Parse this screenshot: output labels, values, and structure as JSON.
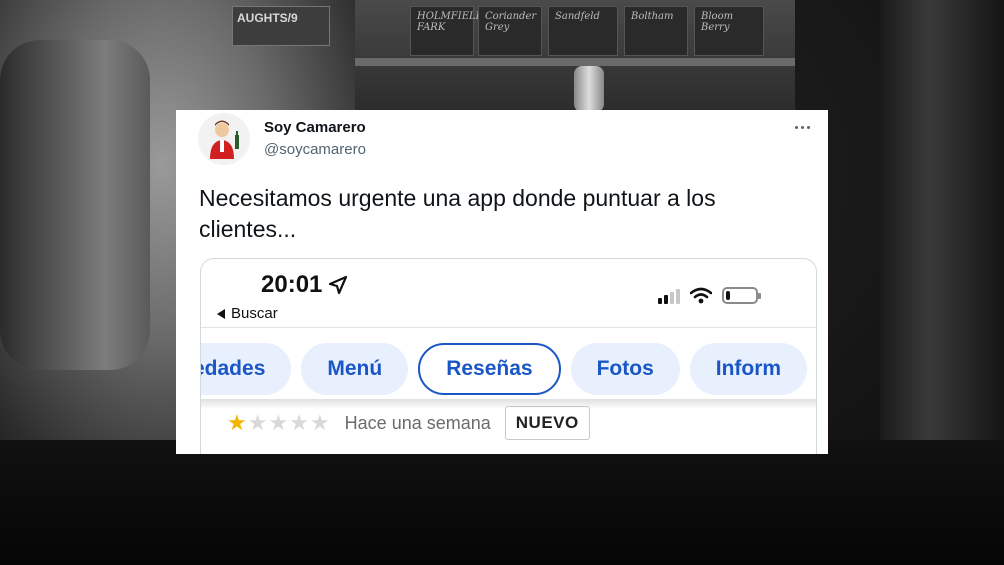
{
  "background": {
    "sign_text": "AUGHTS/9",
    "boards": [
      "HOLMFIELD FARK",
      "Coriander Grey",
      "Sandfeld",
      "Boltham",
      "Bloom Berry"
    ]
  },
  "tweet": {
    "author_name": "Soy Camarero",
    "author_handle": "@soycamarero",
    "more_icon": "more-horizontal-icon",
    "text": "Necesitamos urgente una app donde puntuar a los clientes...",
    "screenshot": {
      "status_time": "20:01",
      "location_icon": "location-arrow-icon",
      "back_label": "Buscar",
      "signal_bars_filled": 2,
      "signal_bars_total": 4,
      "battery_level": 0.15,
      "tabs": [
        {
          "label": "edades",
          "active": false
        },
        {
          "label": "Menú",
          "active": false
        },
        {
          "label": "Reseñas",
          "active": true
        },
        {
          "label": "Fotos",
          "active": false
        },
        {
          "label": "Inform",
          "active": false
        }
      ],
      "review": {
        "rating": 1,
        "max_rating": 5,
        "time_ago": "Hace una semana",
        "badge": "NUEVO"
      }
    },
    "colors": {
      "tab_text": "#1a56c4",
      "tab_bg": "#e8f0fe",
      "star_on": "#f4b400",
      "star_off": "#d9d9d9"
    }
  }
}
